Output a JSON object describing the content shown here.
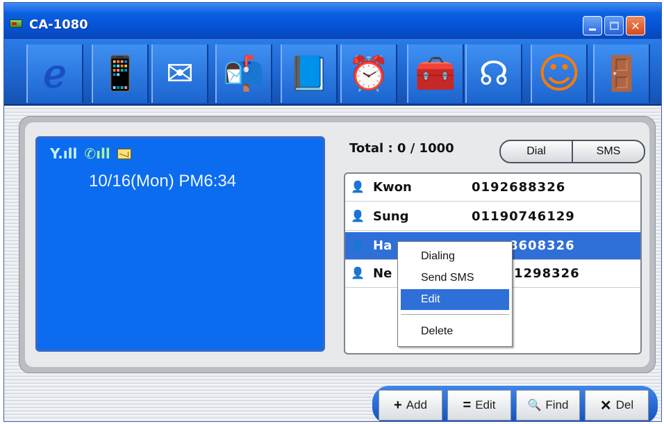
{
  "window": {
    "title": "CA-1080",
    "controls": {
      "minimize": "_",
      "close": "✕"
    }
  },
  "toolbar": [
    {
      "name": "internet-explorer-icon",
      "glyph": "ℯ",
      "color": "#1a4fc4"
    },
    {
      "name": "mobile-phone-icon",
      "glyph": "📱",
      "color": "#222222"
    },
    {
      "name": "write-message-icon",
      "glyph": "✉",
      "color": "#ffffff"
    },
    {
      "name": "mailbox-icon",
      "glyph": "📬",
      "color": "#b3001b"
    },
    {
      "name": "phonebook-icon",
      "glyph": "📘",
      "color": "#1b2f8a"
    },
    {
      "name": "clock-icon",
      "glyph": "⏰",
      "color": "#e9f2ff"
    },
    {
      "name": "toolbox-icon",
      "glyph": "🧰",
      "color": "#b3001b"
    },
    {
      "name": "ring-sound-icon",
      "glyph": "☊",
      "color": "#ffffff"
    },
    {
      "name": "chat-smiley-icon",
      "glyph": "☺",
      "color": "#ff7a00"
    },
    {
      "name": "exit-door-icon",
      "glyph": "🚪",
      "color": "#d8d8d8"
    }
  ],
  "screen": {
    "signal": "Y.ıll",
    "battery": "✆ıll",
    "datetime": "10/16(Mon) PM6:34"
  },
  "contacts": {
    "total_label": "Total : 0 / 1000",
    "dial_label": "Dial",
    "sms_label": "SMS",
    "rows": [
      {
        "name": "Kwon",
        "number": "0192688326"
      },
      {
        "name": "Sung",
        "number": "01190746129"
      },
      {
        "name": "Ha",
        "number": "8608326"
      },
      {
        "name": "Ne",
        "number": "1298326"
      }
    ]
  },
  "context_menu": {
    "items": [
      "Dialing",
      "Send SMS",
      "Edit",
      "Delete"
    ],
    "active": "Edit"
  },
  "bottom_buttons": [
    {
      "icon": "+",
      "label": "Add"
    },
    {
      "icon": "=",
      "label": "Edit"
    },
    {
      "icon": "🔍",
      "label": "Find"
    },
    {
      "icon": "✕",
      "label": "Del"
    }
  ],
  "colors": {
    "titlebar": "#0551d4",
    "screen_blue": "#0b6cf0",
    "selection": "#2f6fd8"
  }
}
